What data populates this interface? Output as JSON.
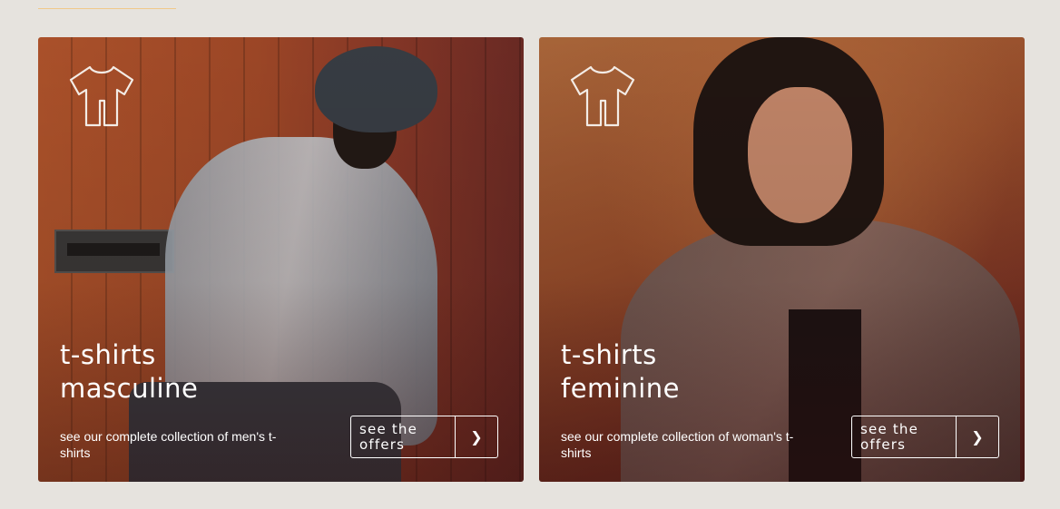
{
  "colors": {
    "page_background": "#e6e3de",
    "accent_line": "#f0c98a",
    "text": "#ffffff"
  },
  "cards": [
    {
      "id": "masculine",
      "icon": "t-shirt-icon",
      "title_line1": "t-shirts",
      "title_line2": "masculine",
      "description": "see our complete collection of men's t-shirts",
      "button_label": "see the offers",
      "button_icon": "chevron-right-icon",
      "button_glyph": "❯"
    },
    {
      "id": "feminine",
      "icon": "t-shirt-icon",
      "title_line1": "t-shirts",
      "title_line2": "feminine",
      "description": "see our complete collection of woman's t-shirts",
      "button_label": "see the offers",
      "button_icon": "chevron-right-icon",
      "button_glyph": "❯"
    }
  ]
}
